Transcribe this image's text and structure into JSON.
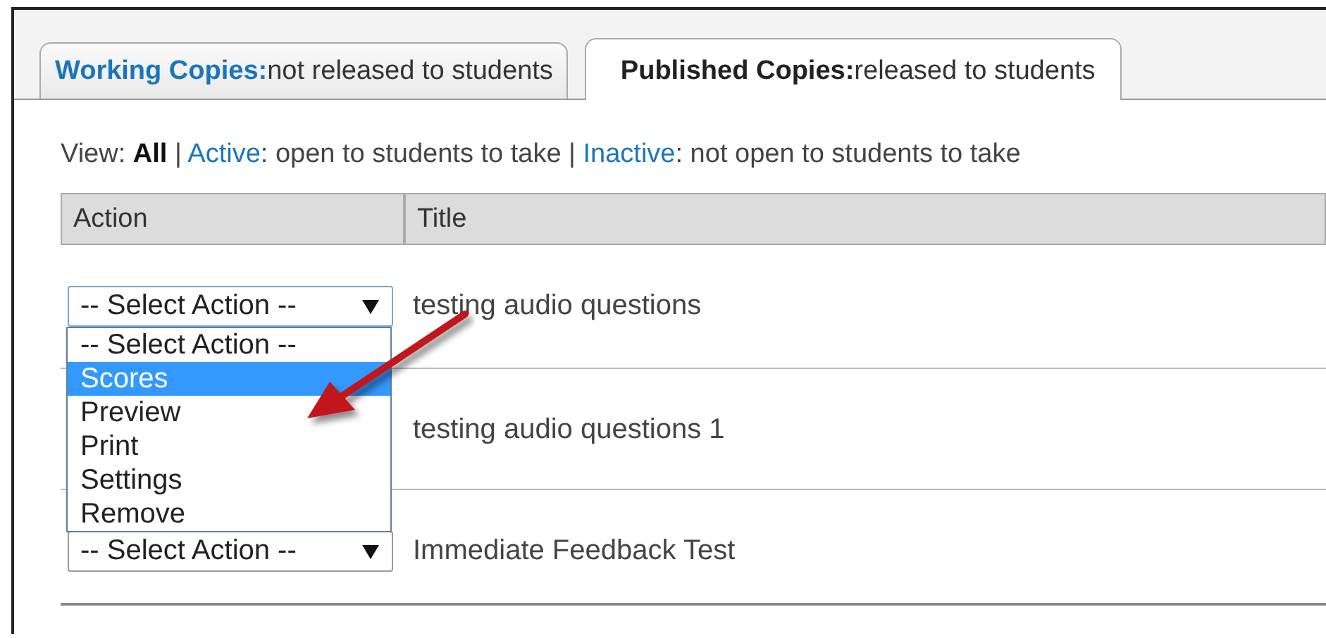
{
  "tabs": [
    {
      "label": "**Working Copies:**not released to students",
      "selected": false
    },
    {
      "label": "**Published Copies:**released to students",
      "selected": true
    }
  ],
  "view_filter": {
    "prefix": "View:",
    "separator": "|",
    "items": [
      {
        "label": "All",
        "selected": true
      },
      {
        "label": "Active",
        "description": ": open to students to take",
        "selected": false
      },
      {
        "label": "Inactive",
        "description": ": not open to students to take",
        "selected": false
      }
    ]
  },
  "table": {
    "columns": [
      "Action",
      "Title"
    ],
    "rows": [
      {
        "action": "-- Select Action --",
        "title": "testing audio questions",
        "dropdown_open": true
      },
      {
        "title": "testing audio questions 1",
        "dropdown_open": false
      },
      {
        "action": "-- Select Action --",
        "title": "Immediate Feedback Test",
        "dropdown_open": false
      }
    ]
  },
  "dropdown_options": [
    {
      "label": "-- Select Action --",
      "selected": false
    },
    {
      "label": "Scores",
      "selected": true
    },
    {
      "label": "Preview",
      "selected": false
    },
    {
      "label": "Print",
      "selected": false
    },
    {
      "label": "Settings",
      "selected": false
    },
    {
      "label": "Remove",
      "selected": false
    }
  ]
}
